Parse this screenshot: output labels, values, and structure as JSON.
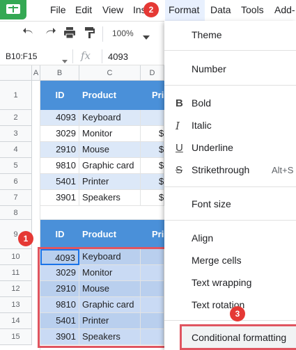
{
  "menu": {
    "items": [
      "File",
      "Edit",
      "View",
      "Ins",
      "Format",
      "Data",
      "Tools",
      "Add-"
    ]
  },
  "toolbar": {
    "zoom": "100%"
  },
  "formula_bar": {
    "name_box": "B10:F15",
    "fx": "fx",
    "value": "4093"
  },
  "grid": {
    "columns": [
      "A",
      "B",
      "C",
      "D"
    ],
    "row_numbers": [
      "1",
      "2",
      "3",
      "4",
      "5",
      "6",
      "7",
      "8",
      "9",
      "10",
      "11",
      "12",
      "13",
      "14",
      "15"
    ],
    "header": {
      "id": "ID",
      "product": "Product",
      "price": "Pri"
    },
    "table1": [
      {
        "id": "4093",
        "product": "Keyboard",
        "price": ""
      },
      {
        "id": "3029",
        "product": "Monitor",
        "price": "$"
      },
      {
        "id": "2910",
        "product": "Mouse",
        "price": "$"
      },
      {
        "id": "9810",
        "product": "Graphic card",
        "price": "$"
      },
      {
        "id": "5401",
        "product": "Printer",
        "price": "$"
      },
      {
        "id": "3901",
        "product": "Speakers",
        "price": "$"
      }
    ],
    "table2": [
      {
        "id": "4093",
        "product": "Keyboard"
      },
      {
        "id": "3029",
        "product": "Monitor"
      },
      {
        "id": "2910",
        "product": "Mouse"
      },
      {
        "id": "9810",
        "product": "Graphic card"
      },
      {
        "id": "5401",
        "product": "Printer"
      },
      {
        "id": "3901",
        "product": "Speakers"
      }
    ]
  },
  "format_menu": {
    "theme": "Theme",
    "number": "Number",
    "bold": "Bold",
    "italic": "Italic",
    "underline": "Underline",
    "strikethrough": "Strikethrough",
    "strikethrough_shortcut": "Alt+S",
    "font_size": "Font size",
    "align": "Align",
    "merge_cells": "Merge cells",
    "text_wrapping": "Text wrapping",
    "text_rotation": "Text rotation",
    "conditional_formatting": "Conditional formatting"
  },
  "badges": {
    "one": "1",
    "two": "2",
    "three": "3"
  },
  "colors": {
    "header_blue": "#4a90d9",
    "band_light": "#dce8f8",
    "highlight_red": "#e05560",
    "badge_red": "#e53935",
    "sheets_green": "#34a853"
  },
  "icons": [
    "undo-icon",
    "redo-icon",
    "print-icon",
    "paint-format-icon",
    "dropdown-arrow-icon",
    "bold-icon",
    "italic-icon",
    "underline-icon",
    "strikethrough-icon"
  ]
}
